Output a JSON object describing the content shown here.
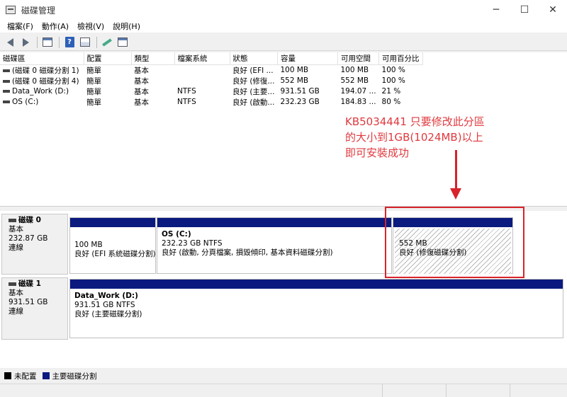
{
  "window": {
    "title": "磁碟管理",
    "controls": [
      "─",
      "☐",
      "✕"
    ]
  },
  "menu": [
    "檔案(F)",
    "動作(A)",
    "檢視(V)",
    "說明(H)"
  ],
  "table": {
    "headers": [
      "磁碟區",
      "配置",
      "類型",
      "檔案系統",
      "狀態",
      "容量",
      "可用空間",
      "可用百分比"
    ],
    "rows": [
      [
        "(磁碟 0 磁碟分割 1)",
        "簡單",
        "基本",
        "",
        "良好 (EFI ...",
        "100 MB",
        "100 MB",
        "100 %"
      ],
      [
        "(磁碟 0 磁碟分割 4)",
        "簡單",
        "基本",
        "",
        "良好 (修復...",
        "552 MB",
        "552 MB",
        "100 %"
      ],
      [
        "Data_Work (D:)",
        "簡單",
        "基本",
        "NTFS",
        "良好 (主要...",
        "931.51 GB",
        "194.07 ...",
        "21 %"
      ],
      [
        "OS (C:)",
        "簡單",
        "基本",
        "NTFS",
        "良好 (啟動...",
        "232.23 GB",
        "184.83 ...",
        "80 %"
      ]
    ]
  },
  "annotation": {
    "lines": [
      "KB5034441 只要修改此分區",
      "的大小到1GB(1024MB)以上",
      "即可安裝成功"
    ]
  },
  "disks": [
    {
      "name": "磁碟 0",
      "type": "基本",
      "size": "232.87 GB",
      "status": "連線",
      "partitions": [
        {
          "name": "",
          "size": "100 MB",
          "status": "良好 (EFI 系統磁碟分割)"
        },
        {
          "name": "OS (C:)",
          "size": "232.23 GB NTFS",
          "status": "良好 (啟動, 分頁檔案, 損毀傾印, 基本資料磁碟分割)"
        },
        {
          "name": "",
          "size": "552 MB",
          "status": "良好 (修復磁碟分割)"
        }
      ]
    },
    {
      "name": "磁碟 1",
      "type": "基本",
      "size": "931.51 GB",
      "status": "連線",
      "partitions": [
        {
          "name": "Data_Work (D:)",
          "size": "931.51 GB NTFS",
          "status": "良好 (主要磁碟分割)"
        }
      ]
    }
  ],
  "legend": [
    {
      "label": "未配置",
      "color": "#000000"
    },
    {
      "label": "主要磁碟分割",
      "color": "#0a1a7e"
    }
  ]
}
